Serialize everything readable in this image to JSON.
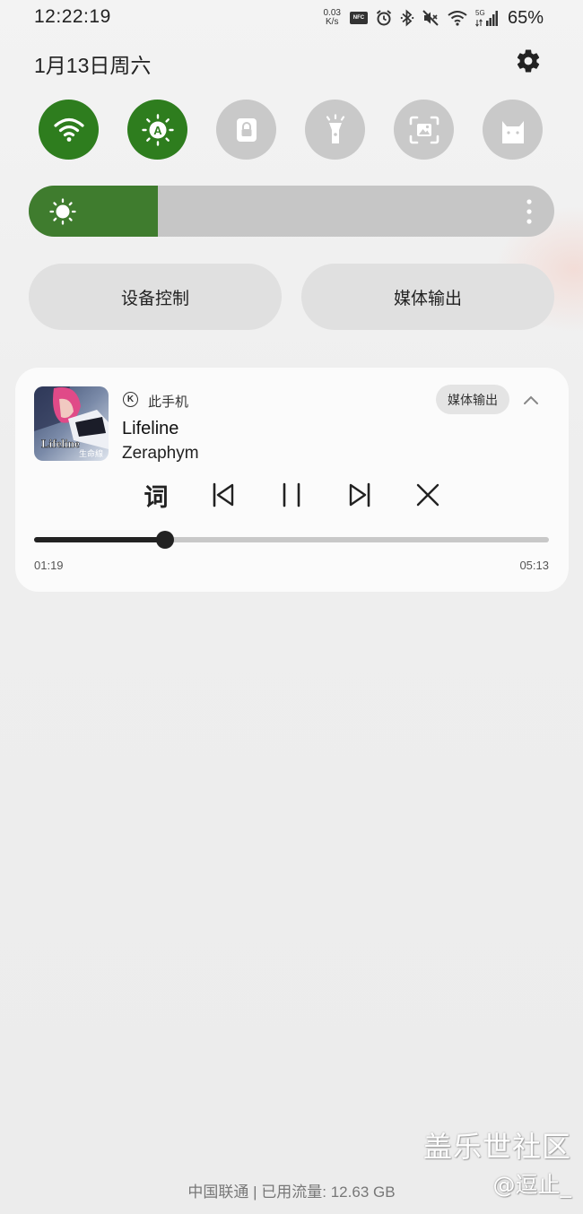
{
  "status_bar": {
    "time": "12:22:19",
    "net_speed_value": "0.03",
    "net_speed_unit": "K/s",
    "nfc_label": "NFC",
    "network_type": "5G",
    "battery_percent": "65%",
    "icons": [
      "nfc-icon",
      "alarm-icon",
      "bluetooth-icon",
      "mute-icon",
      "wifi-icon",
      "signal-icon"
    ]
  },
  "header": {
    "date": "1月13日周六",
    "settings_icon": "gear-icon"
  },
  "quick_toggles": [
    {
      "name": "wifi",
      "icon": "wifi-icon",
      "on": true
    },
    {
      "name": "auto-brightness",
      "icon": "auto-brightness-icon",
      "on": true
    },
    {
      "name": "screen-lock",
      "icon": "lock-icon",
      "on": false
    },
    {
      "name": "flashlight",
      "icon": "flashlight-icon",
      "on": false
    },
    {
      "name": "screenshot",
      "icon": "screenshot-icon",
      "on": false
    },
    {
      "name": "cat-app",
      "icon": "cat-icon",
      "on": false
    }
  ],
  "brightness": {
    "level": 0.245
  },
  "colors": {
    "accent_green": "#2e7d1e",
    "brightness_green": "#3f7c2e",
    "toggle_off": "#c9c9c9"
  },
  "buttons": {
    "device_control": "设备控制",
    "media_output": "媒体输出"
  },
  "media": {
    "app_icon_letter": "K",
    "source": "此手机",
    "output_chip": "媒体输出",
    "album_text": "Lifeline",
    "album_subtext": "生命線",
    "title": "Lifeline",
    "artist": "Zeraphym",
    "lyrics_label": "词",
    "current_time": "01:19",
    "total_time": "05:13",
    "progress": 0.254
  },
  "footer": {
    "carrier_info": "中国联通 | 已用流量: 12.63 GB",
    "watermark": "盖乐世社区",
    "watermark_user": "@逗止_"
  }
}
